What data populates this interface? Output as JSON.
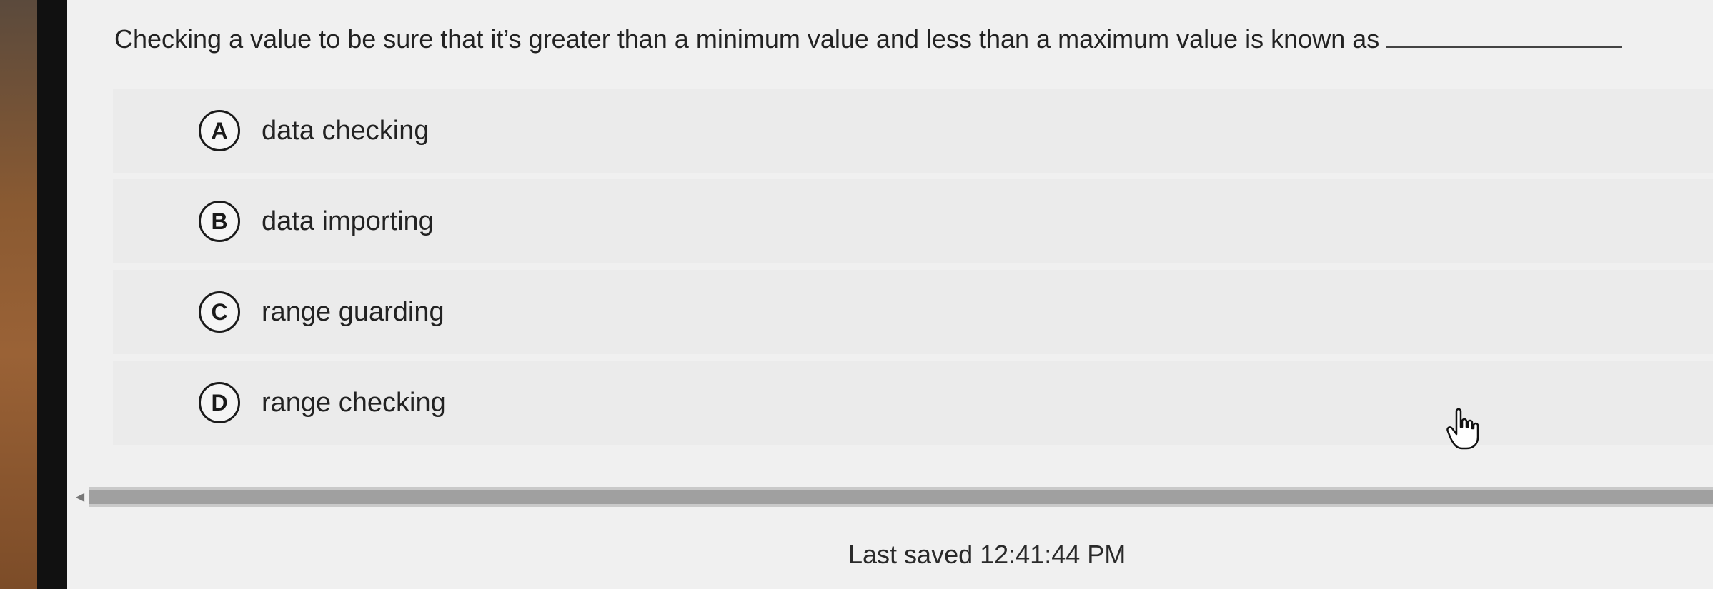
{
  "question": {
    "text": "Checking a value to be sure that it’s greater than a minimum value and less than a maximum value is known as"
  },
  "options": [
    {
      "letter": "A",
      "label": "data checking"
    },
    {
      "letter": "B",
      "label": "data importing"
    },
    {
      "letter": "C",
      "label": "range guarding"
    },
    {
      "letter": "D",
      "label": "range checking"
    }
  ],
  "scrollbar": {
    "left_arrow_icon": "chevron-left-icon"
  },
  "footer": {
    "last_saved": "Last saved 12:41:44 PM"
  },
  "cursor": {
    "icon": "hand-pointer-icon"
  }
}
